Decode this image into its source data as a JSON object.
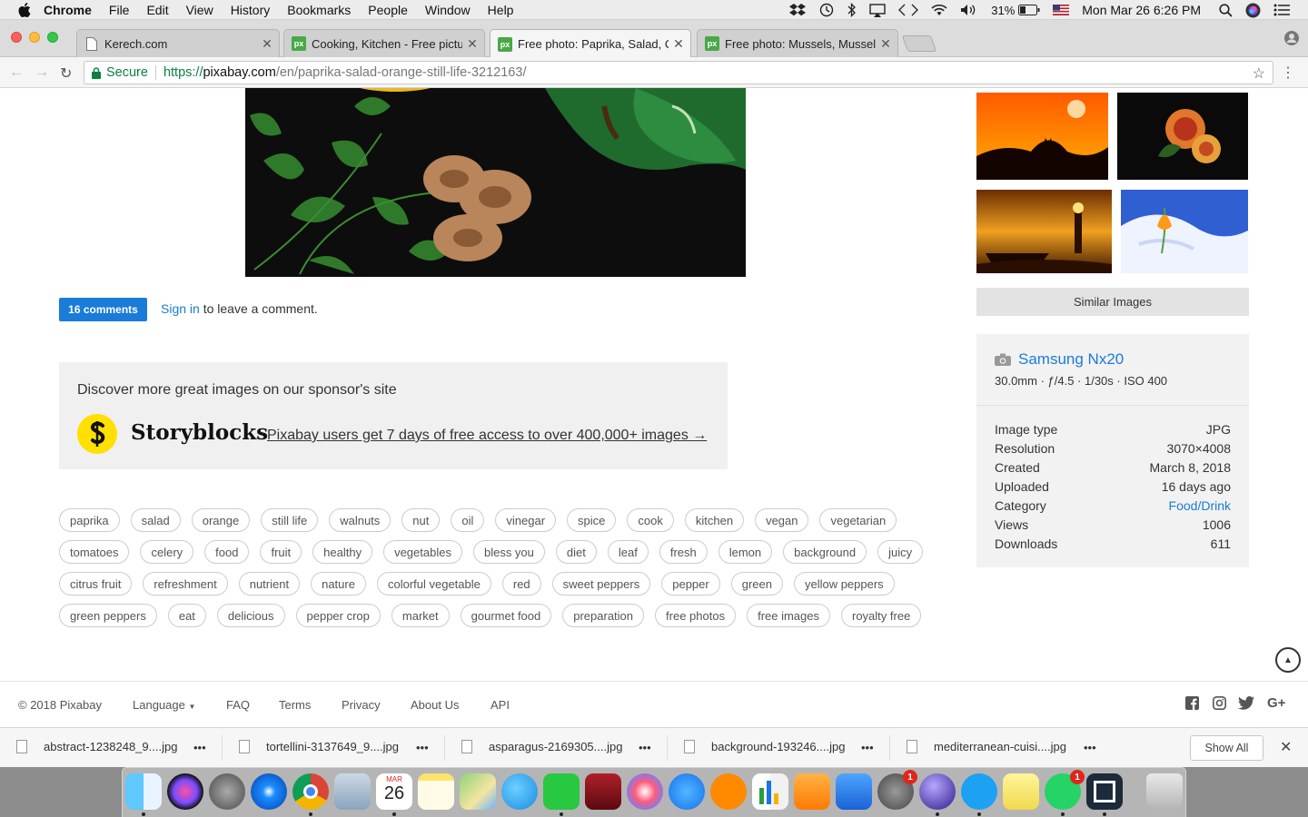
{
  "menubar": {
    "app_name": "Chrome",
    "items": [
      "File",
      "Edit",
      "View",
      "History",
      "Bookmarks",
      "People",
      "Window",
      "Help"
    ],
    "battery": "31%",
    "clock": "Mon Mar 26  6:26 PM"
  },
  "tabs": [
    {
      "title": "Kerech.com",
      "favicon": "page-icon",
      "active": false
    },
    {
      "title": "Cooking, Kitchen - Free picture",
      "favicon": "px",
      "active": false
    },
    {
      "title": "Free photo: Paprika, Salad, Ora",
      "favicon": "px",
      "active": true
    },
    {
      "title": "Free photo: Mussels, Mussel, S",
      "favicon": "px",
      "active": false
    }
  ],
  "address": {
    "secure_label": "Secure",
    "scheme": "https://",
    "host": "pixabay.com",
    "path": "/en/paprika-salad-orange-still-life-3212163/"
  },
  "comments": {
    "button": "16 comments",
    "signin": "Sign in",
    "signin_rest": " to leave a comment."
  },
  "sponsor": {
    "discover": "Discover more great images on our sponsor's site",
    "brand": "Storyblocks",
    "offer": "Pixabay users get 7 days of free access to over 400,000+ images →"
  },
  "tags": [
    [
      "paprika",
      "salad",
      "orange",
      "still life",
      "walnuts",
      "nut",
      "oil",
      "vinegar",
      "spice",
      "cook",
      "kitchen",
      "vegan",
      "vegetarian"
    ],
    [
      "tomatoes",
      "celery",
      "food",
      "fruit",
      "healthy",
      "vegetables",
      "bless you",
      "diet",
      "leaf",
      "fresh",
      "lemon",
      "background",
      "juicy"
    ],
    [
      "citrus fruit",
      "refreshment",
      "nutrient",
      "nature",
      "colorful vegetable",
      "red",
      "sweet peppers",
      "pepper",
      "green",
      "yellow peppers"
    ],
    [
      "green peppers",
      "eat",
      "delicious",
      "pepper crop",
      "market",
      "gourmet food",
      "preparation",
      "free photos",
      "free images",
      "royalty free"
    ]
  ],
  "sidebar": {
    "similar": "Similar Images",
    "camera_model": "Samsung Nx20",
    "camera_specs": "30.0mm · ƒ/4.5 · 1/30s · ISO 400",
    "details": [
      {
        "label": "Image type",
        "value": "JPG"
      },
      {
        "label": "Resolution",
        "value": "3070×4008"
      },
      {
        "label": "Created",
        "value": "March 8, 2018"
      },
      {
        "label": "Uploaded",
        "value": "16 days ago"
      },
      {
        "label": "Category",
        "value": "Food/Drink"
      },
      {
        "label": "Views",
        "value": "1006"
      },
      {
        "label": "Downloads",
        "value": "611"
      }
    ]
  },
  "footer": {
    "copyright": "© 2018 Pixabay",
    "language": "Language",
    "faq": "FAQ",
    "terms": "Terms",
    "privacy": "Privacy",
    "about": "About Us",
    "api": "API"
  },
  "downloads": {
    "files": [
      "abstract-1238248_9....jpg",
      "tortellini-3137649_9....jpg",
      "asparagus-2169305....jpg",
      "background-193246....jpg",
      "mediterranean-cuisi....jpg"
    ],
    "dots": "•••",
    "show_all": "Show All"
  },
  "dock": {
    "calendar_month": "MAR",
    "calendar_day": "26",
    "badges": [
      "1",
      "1"
    ]
  },
  "colors": {
    "accent": "#1a7bd8",
    "secure_green": "#0b8043",
    "sponsor_yellow": "#ffe000"
  }
}
